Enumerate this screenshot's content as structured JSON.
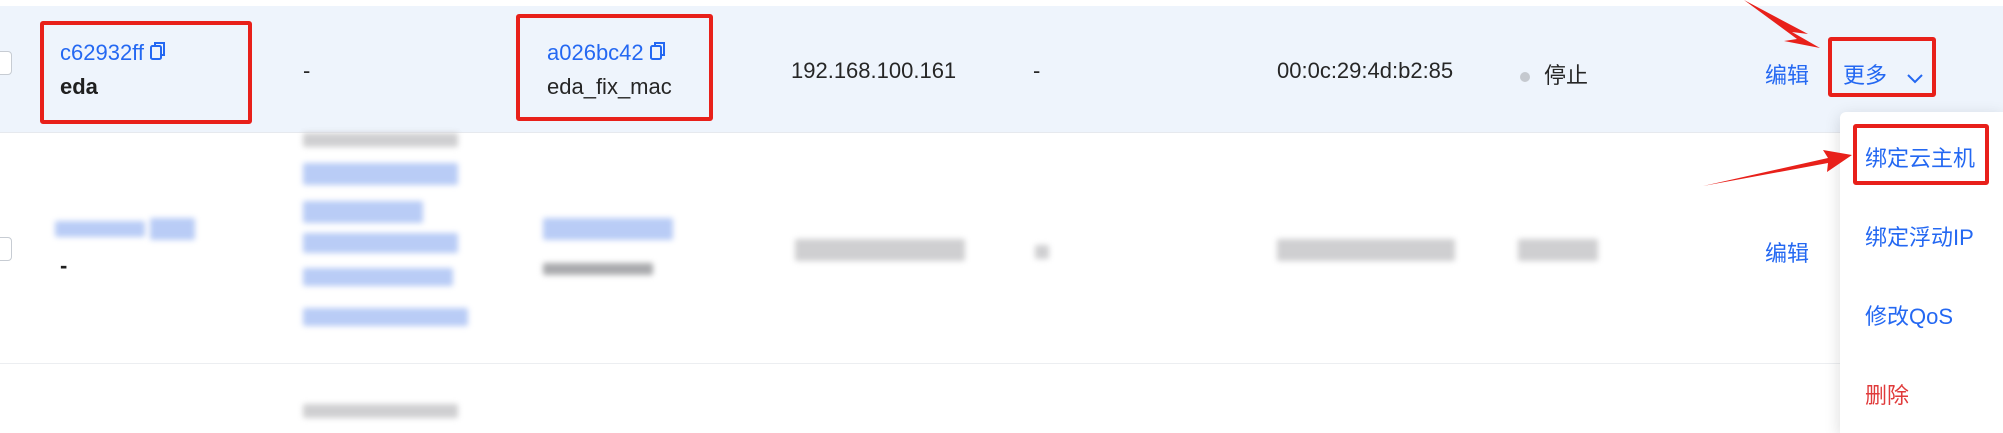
{
  "rows": [
    {
      "id": "c62932ff",
      "name": "eda",
      "col2": "-",
      "port_id": "a026bc42",
      "port_name": "eda_fix_mac",
      "ip": "192.168.100.161",
      "col5": "-",
      "mac": "00:0c:29:4d:b2:85",
      "status": "停止",
      "edit_label": "编辑",
      "more_label": "更多"
    },
    {
      "name": "-",
      "edit_label": "编辑"
    }
  ],
  "dropdown": {
    "items": [
      {
        "label": "绑定云主机",
        "color": "#2468f2"
      },
      {
        "label": "绑定浮动IP",
        "color": "#2468f2"
      },
      {
        "label": "修改QoS",
        "color": "#2468f2"
      },
      {
        "label": "删除",
        "color": "#e03a3a"
      }
    ]
  },
  "colors": {
    "accent": "#2468f2",
    "highlight": "#e8201a",
    "danger": "#e03a3a",
    "row_selected": "#eef4fc"
  },
  "icons": [
    "copy-icon",
    "chevron-down-icon",
    "status-dot-icon"
  ]
}
